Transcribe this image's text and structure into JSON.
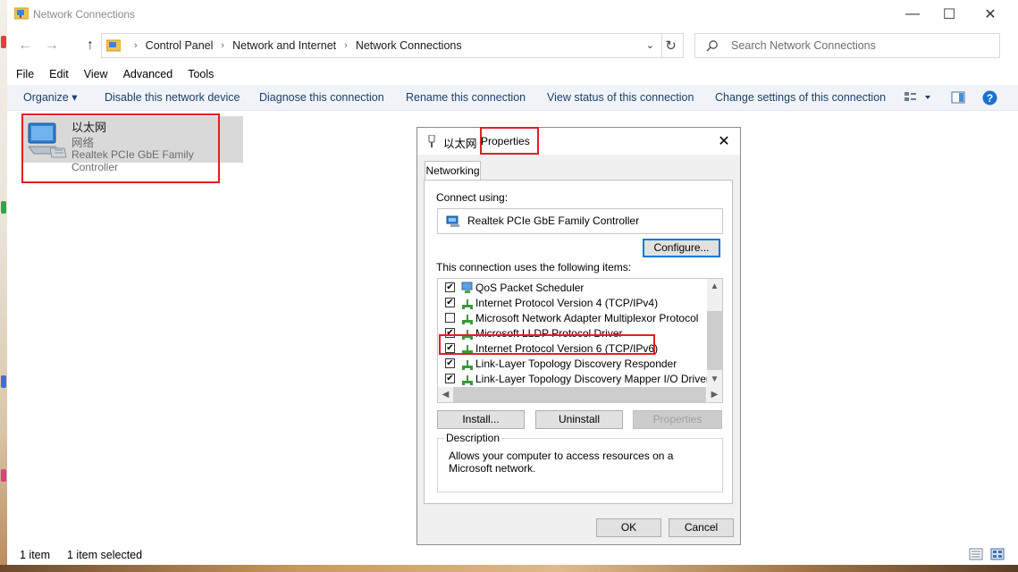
{
  "window": {
    "title": "Network Connections",
    "controls": {
      "minimize": "—",
      "maximize": "☐",
      "close": "✕"
    }
  },
  "nav": {
    "back": "←",
    "forward": "→",
    "up": "↑",
    "breadcrumbs": [
      "Control Panel",
      "Network and Internet",
      "Network Connections"
    ],
    "dropdown": "⌄",
    "refresh": "↻",
    "search_placeholder": "Search Network Connections"
  },
  "menu": [
    "File",
    "Edit",
    "View",
    "Advanced",
    "Tools"
  ],
  "commands": {
    "organize": "Organize ▾",
    "disable": "Disable this network device",
    "diagnose": "Diagnose this connection",
    "rename": "Rename this connection",
    "view_status": "View status of this connection",
    "change_settings": "Change settings of this connection",
    "help": "?"
  },
  "connection": {
    "name": "以太网",
    "type": "网络",
    "adapter": "Realtek PCIe GbE Family Controller"
  },
  "status": {
    "count": "1 item",
    "selected": "1 item selected"
  },
  "dialog": {
    "title_name": "以太网",
    "title_suffix": "Properties",
    "close": "✕",
    "tab": "Networking",
    "connect_using_label": "Connect using:",
    "adapter": "Realtek PCIe GbE Family Controller",
    "configure": "Configure...",
    "items_label": "This connection uses the following items:",
    "items": [
      {
        "label": "QoS Packet Scheduler",
        "checked": true,
        "icon": "qos-icon"
      },
      {
        "label": "Internet Protocol Version 4 (TCP/IPv4)",
        "checked": true,
        "icon": "protocol-icon"
      },
      {
        "label": "Microsoft Network Adapter Multiplexor Protocol",
        "checked": false,
        "icon": "protocol-icon"
      },
      {
        "label": "Microsoft LLDP Protocol Driver",
        "checked": true,
        "icon": "protocol-icon"
      },
      {
        "label": "Internet Protocol Version 6 (TCP/IPv6)",
        "checked": true,
        "icon": "protocol-icon"
      },
      {
        "label": "Link-Layer Topology Discovery Responder",
        "checked": true,
        "icon": "protocol-icon"
      },
      {
        "label": "Link-Layer Topology Discovery Mapper I/O Driver",
        "checked": true,
        "icon": "protocol-icon"
      }
    ],
    "install": "Install...",
    "uninstall": "Uninstall",
    "properties": "Properties",
    "description_label": "Description",
    "description": "Allows your computer to access resources on a Microsoft network.",
    "ok": "OK",
    "cancel": "Cancel"
  },
  "colors": {
    "accent": "#0078d7",
    "highlight_box": "#e02020",
    "command_text": "#1a3f6a"
  }
}
